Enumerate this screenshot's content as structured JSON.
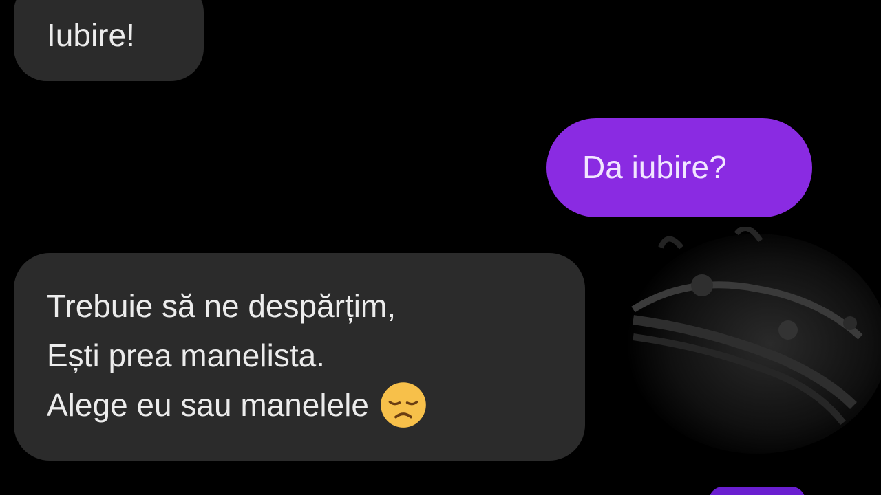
{
  "messages": [
    {
      "direction": "incoming",
      "text": "Iubire!"
    },
    {
      "direction": "outgoing",
      "text": "Da iubire?"
    },
    {
      "direction": "incoming",
      "lines": [
        "Trebuie să ne despărțim,",
        "Ești prea manelista.",
        "Alege eu sau manelele"
      ],
      "emoji": "disappointed-face-icon"
    }
  ],
  "colors": {
    "background": "#000000",
    "incoming_bubble": "#2b2b2b",
    "outgoing_bubble": "#8a2be2"
  }
}
